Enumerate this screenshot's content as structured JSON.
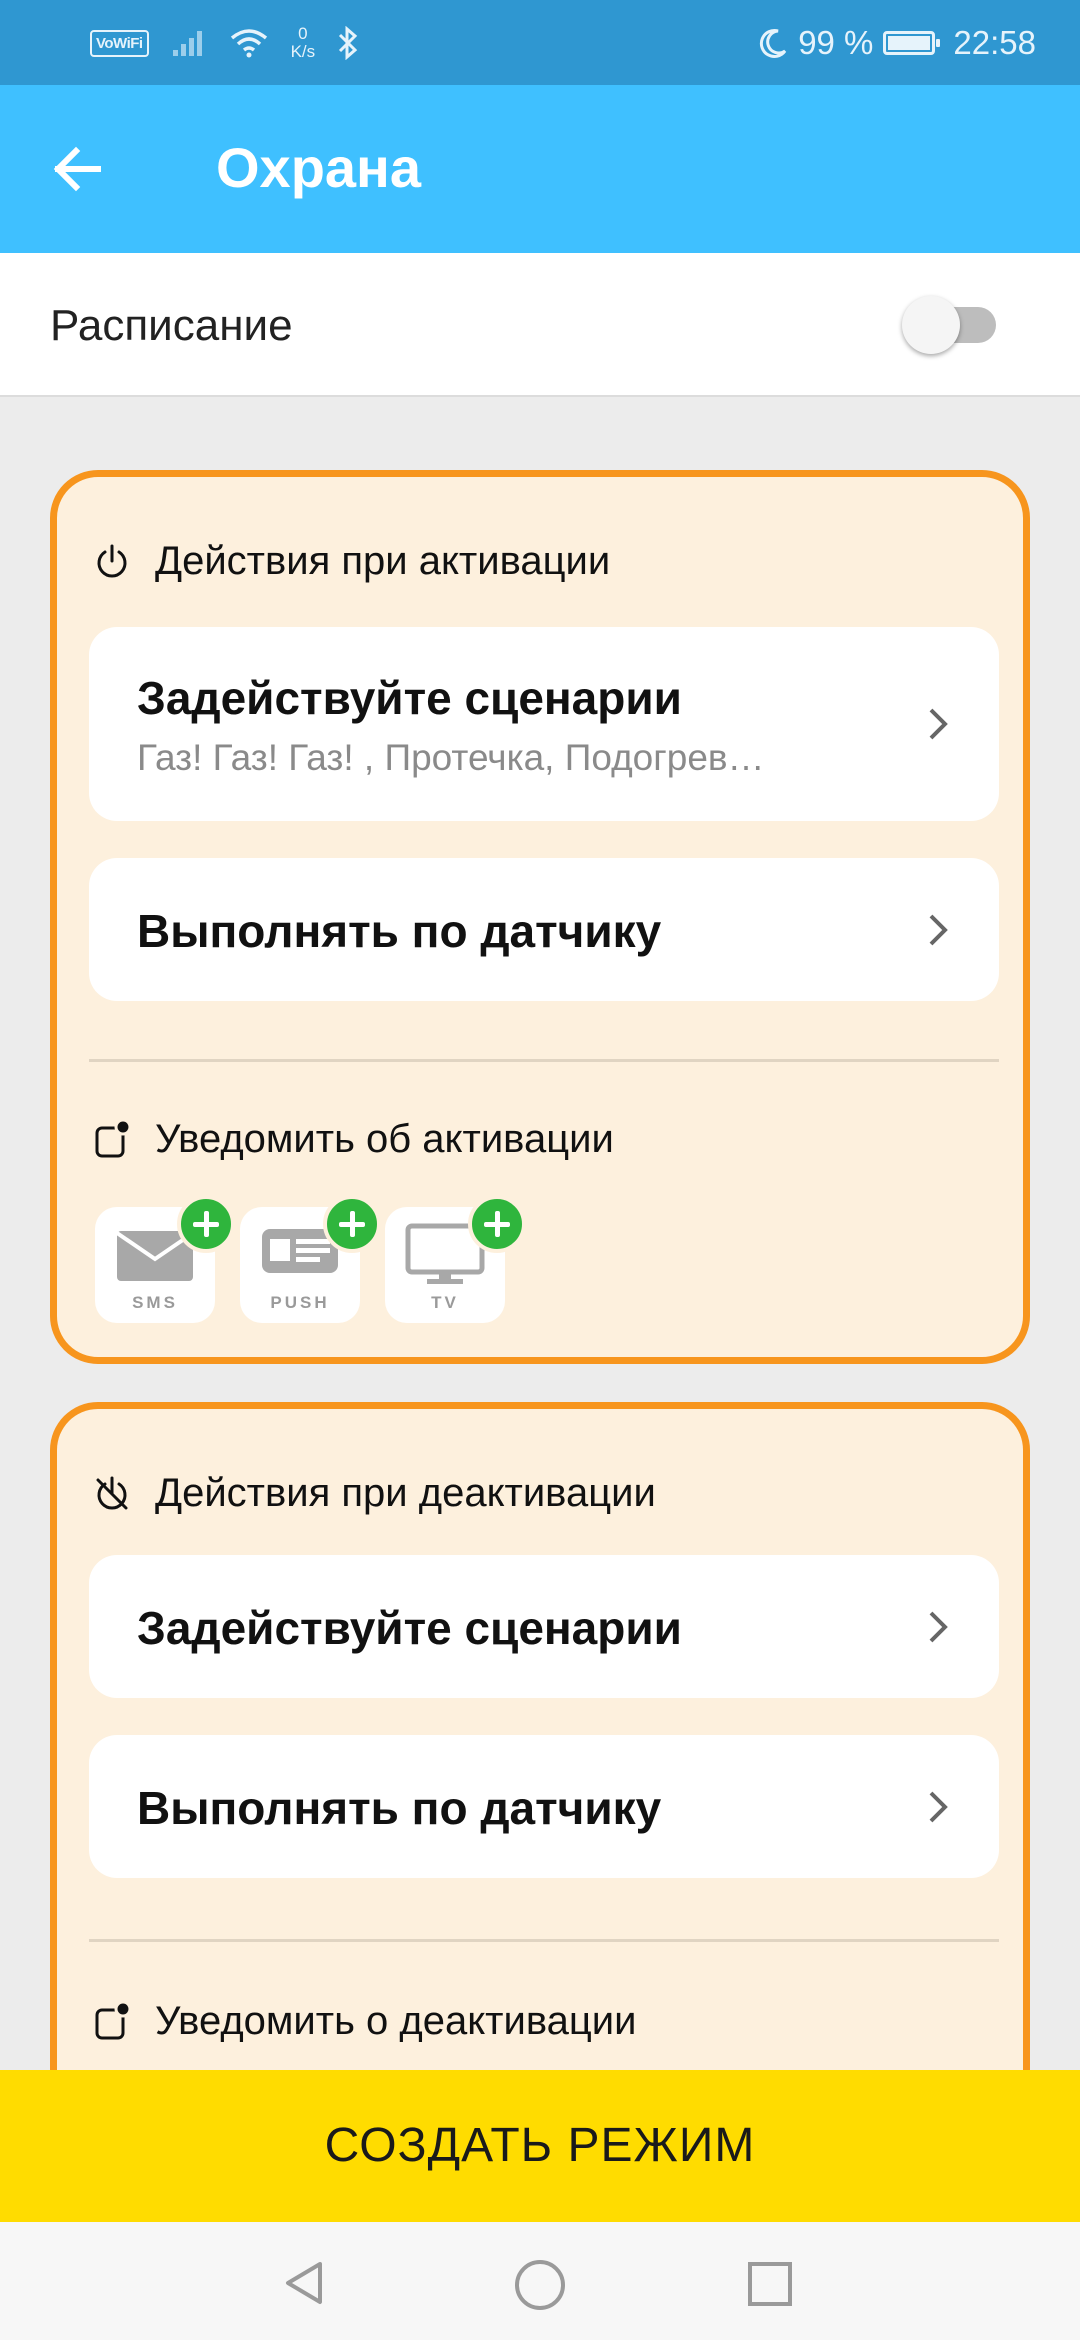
{
  "status_bar": {
    "vowifi": "VoWiFi",
    "speed_value": "0",
    "speed_unit": "K/s",
    "battery": "99 %",
    "battery_level": 0.99,
    "time": "22:58"
  },
  "appbar": {
    "title": "Охрана"
  },
  "schedule": {
    "label": "Расписание",
    "enabled": false
  },
  "activation": {
    "header": "Действия при активации",
    "scenarios_title": "Задействуйте сценарии",
    "scenarios_sub": "Газ! Газ! Газ! , Протечка, Подогрев…",
    "sensor_title": "Выполнять по датчику",
    "notify_header": "Уведомить об активации",
    "channels": [
      "SMS",
      "PUSH",
      "TV"
    ]
  },
  "deactivation": {
    "header": "Действия при деактивации",
    "scenarios_title": "Задействуйте сценарии",
    "sensor_title": "Выполнять по датчику",
    "notify_header": "Уведомить о деактивации"
  },
  "create_button": "СОЗДАТЬ РЕЖИМ",
  "colors": {
    "accent": "#3fc0ff",
    "card_border": "#f7951d",
    "card_bg": "#fdf0dd",
    "button": "#ffdc00",
    "plus": "#2fb53d"
  }
}
